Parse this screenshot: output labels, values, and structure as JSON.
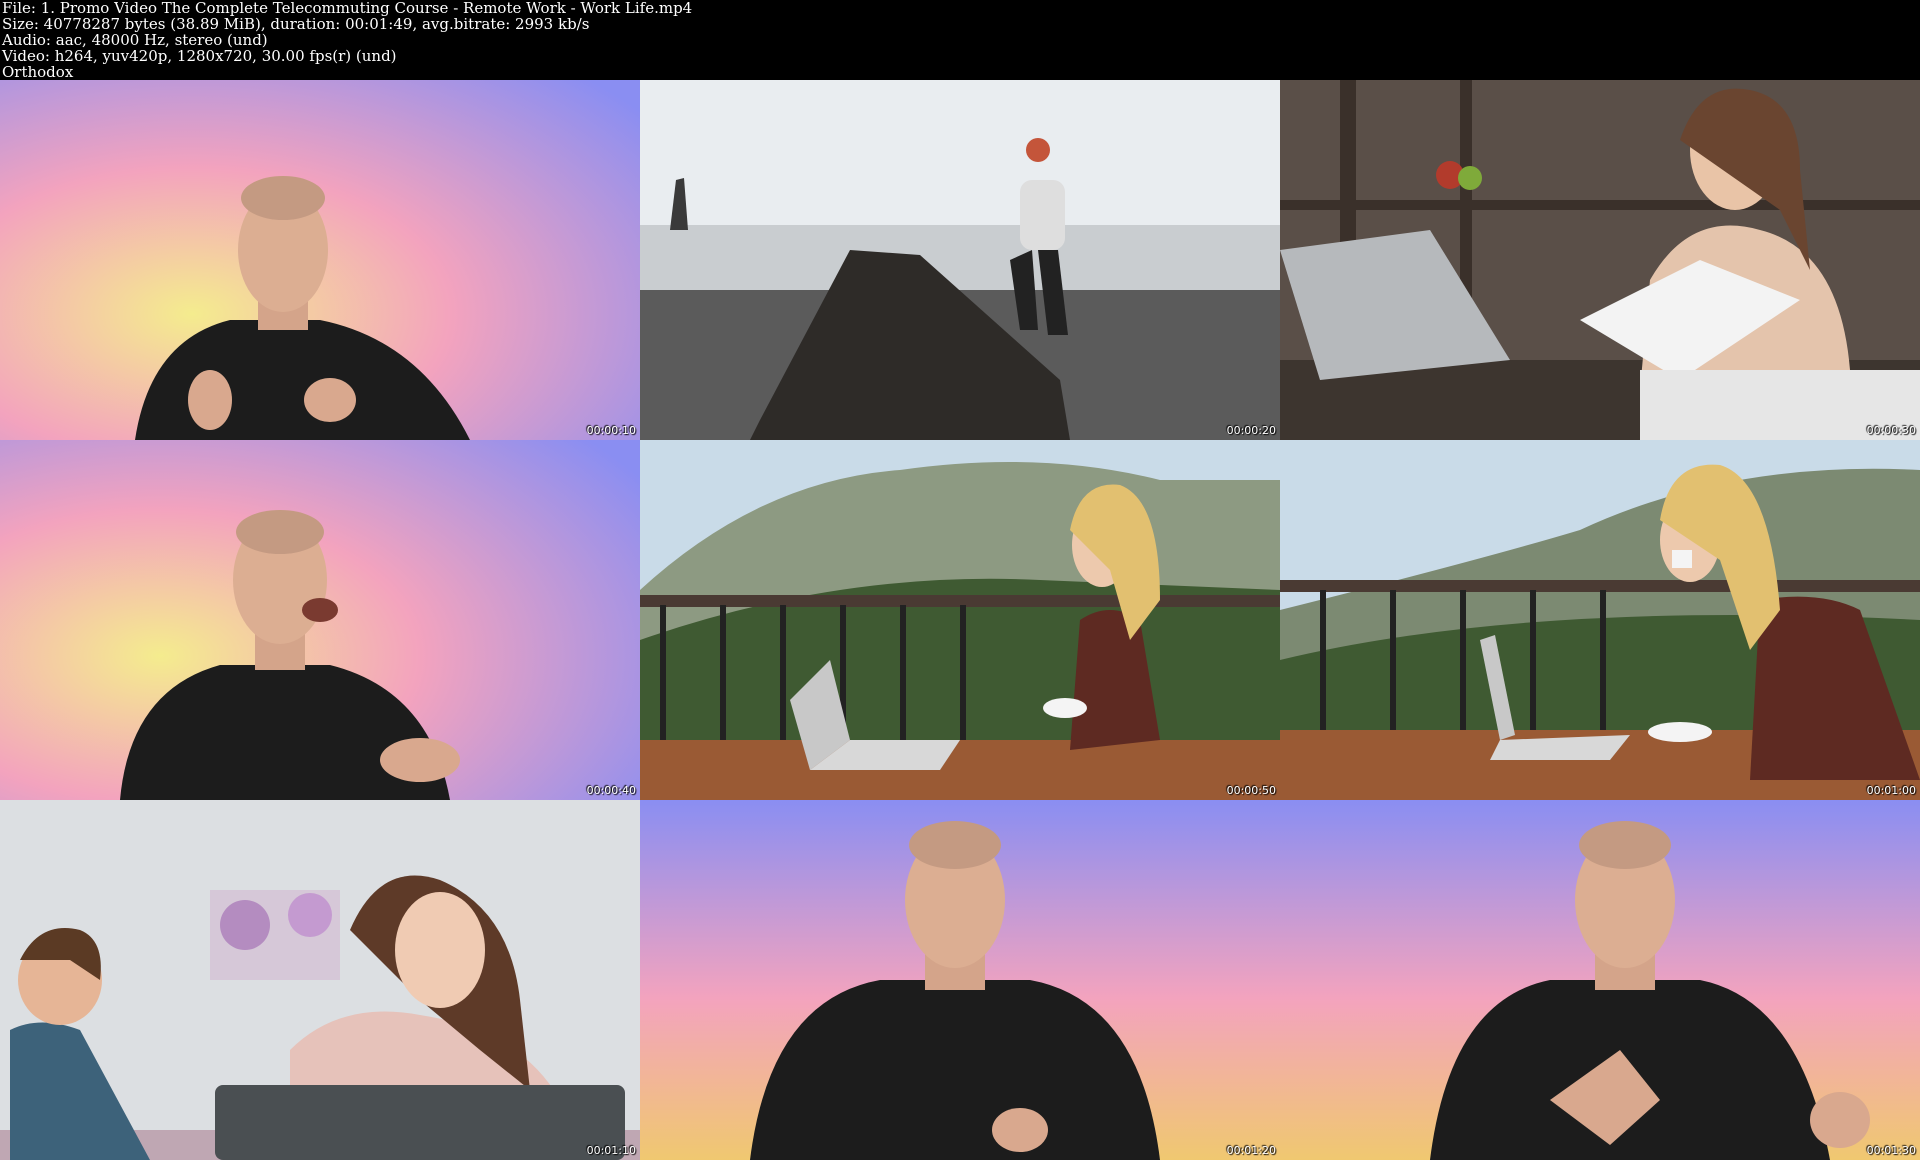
{
  "header": {
    "file": "File: 1. Promo Video The Complete Telecommuting Course - Remote Work - Work Life.mp4",
    "size": "Size: 40778287 bytes (38.89 MiB), duration: 00:01:49, avg.bitrate: 2993 kb/s",
    "audio": "Audio: aac, 48000 Hz, stereo (und)",
    "video": "Video: h264, yuv420p, 1280x720, 30.00 fps(r) (und)",
    "tag": "Orthodox"
  },
  "thumbnails": [
    {
      "scene": "presenter",
      "timestamp": "00:00:10"
    },
    {
      "scene": "beach",
      "timestamp": "00:00:20"
    },
    {
      "scene": "office",
      "timestamp": "00:00:30"
    },
    {
      "scene": "presenter",
      "timestamp": "00:00:40"
    },
    {
      "scene": "balcony-laptop",
      "timestamp": "00:00:50"
    },
    {
      "scene": "balcony-coffee",
      "timestamp": "00:01:00"
    },
    {
      "scene": "headache",
      "timestamp": "00:01:10"
    },
    {
      "scene": "presenter",
      "timestamp": "00:01:20"
    },
    {
      "scene": "presenter",
      "timestamp": "00:01:30"
    }
  ],
  "colors": {
    "presenter_bg": [
      "#8e8ef0",
      "#f7a0c0",
      "#f0e890"
    ],
    "sky": "#e8eef2",
    "shirt": "#1a1a1a"
  }
}
